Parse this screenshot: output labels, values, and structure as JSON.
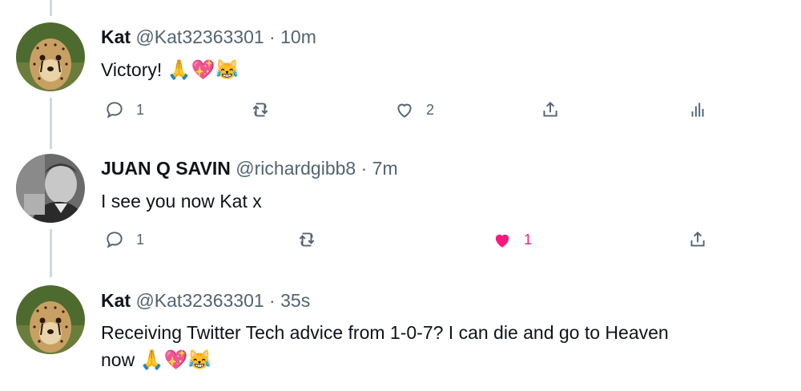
{
  "tweets": [
    {
      "name": "Kat",
      "handle": "@Kat32363301",
      "separator": "·",
      "time": "10m",
      "text": "Victory!",
      "emojis": "🙏💖😹",
      "reply_count": "1",
      "like_count": "2",
      "liked": false
    },
    {
      "name": "JUAN Q SAVIN",
      "handle": "@richardgibb8",
      "separator": "·",
      "time": "7m",
      "text": "I see you now Kat x",
      "reply_count": "1",
      "like_count": "1",
      "liked": true
    },
    {
      "name": "Kat",
      "handle": "@Kat32363301",
      "separator": "·",
      "time": "35s",
      "text_line1": "Receiving Twitter Tech advice from 1-0-7? I can die and go to Heaven",
      "text_line2": "now",
      "emojis": "🙏💖😹"
    }
  ],
  "colors": {
    "text": "#0f1419",
    "secondary": "#536471",
    "like_active": "#f91880",
    "thread_line": "#cfd9de"
  },
  "icons": [
    "reply-icon",
    "retweet-icon",
    "like-icon",
    "share-icon",
    "analytics-icon"
  ]
}
